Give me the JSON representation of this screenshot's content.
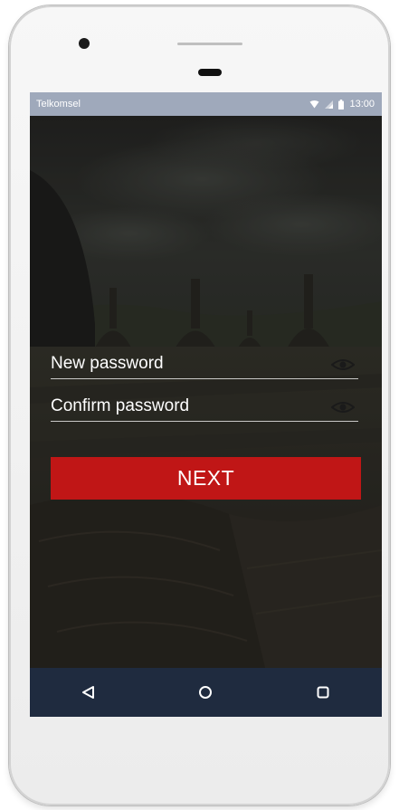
{
  "status_bar": {
    "carrier": "Telkomsel",
    "time": "13:00",
    "icons": [
      "wifi-icon",
      "signal-icon",
      "battery-icon"
    ]
  },
  "form": {
    "new_password": {
      "placeholder": "New password",
      "value": "",
      "toggle_icon": "eye-icon"
    },
    "confirm_password": {
      "placeholder": "Confirm password",
      "value": "",
      "toggle_icon": "eye-icon"
    },
    "next_label": "NEXT"
  },
  "nav_bar": {
    "icons": [
      "back-triangle-icon",
      "home-circle-icon",
      "recents-square-icon"
    ]
  },
  "colors": {
    "status_bar": "#9fa9bb",
    "accent_button": "#c01616",
    "nav_bar": "#1f2b3f",
    "text": "#ffffff"
  }
}
